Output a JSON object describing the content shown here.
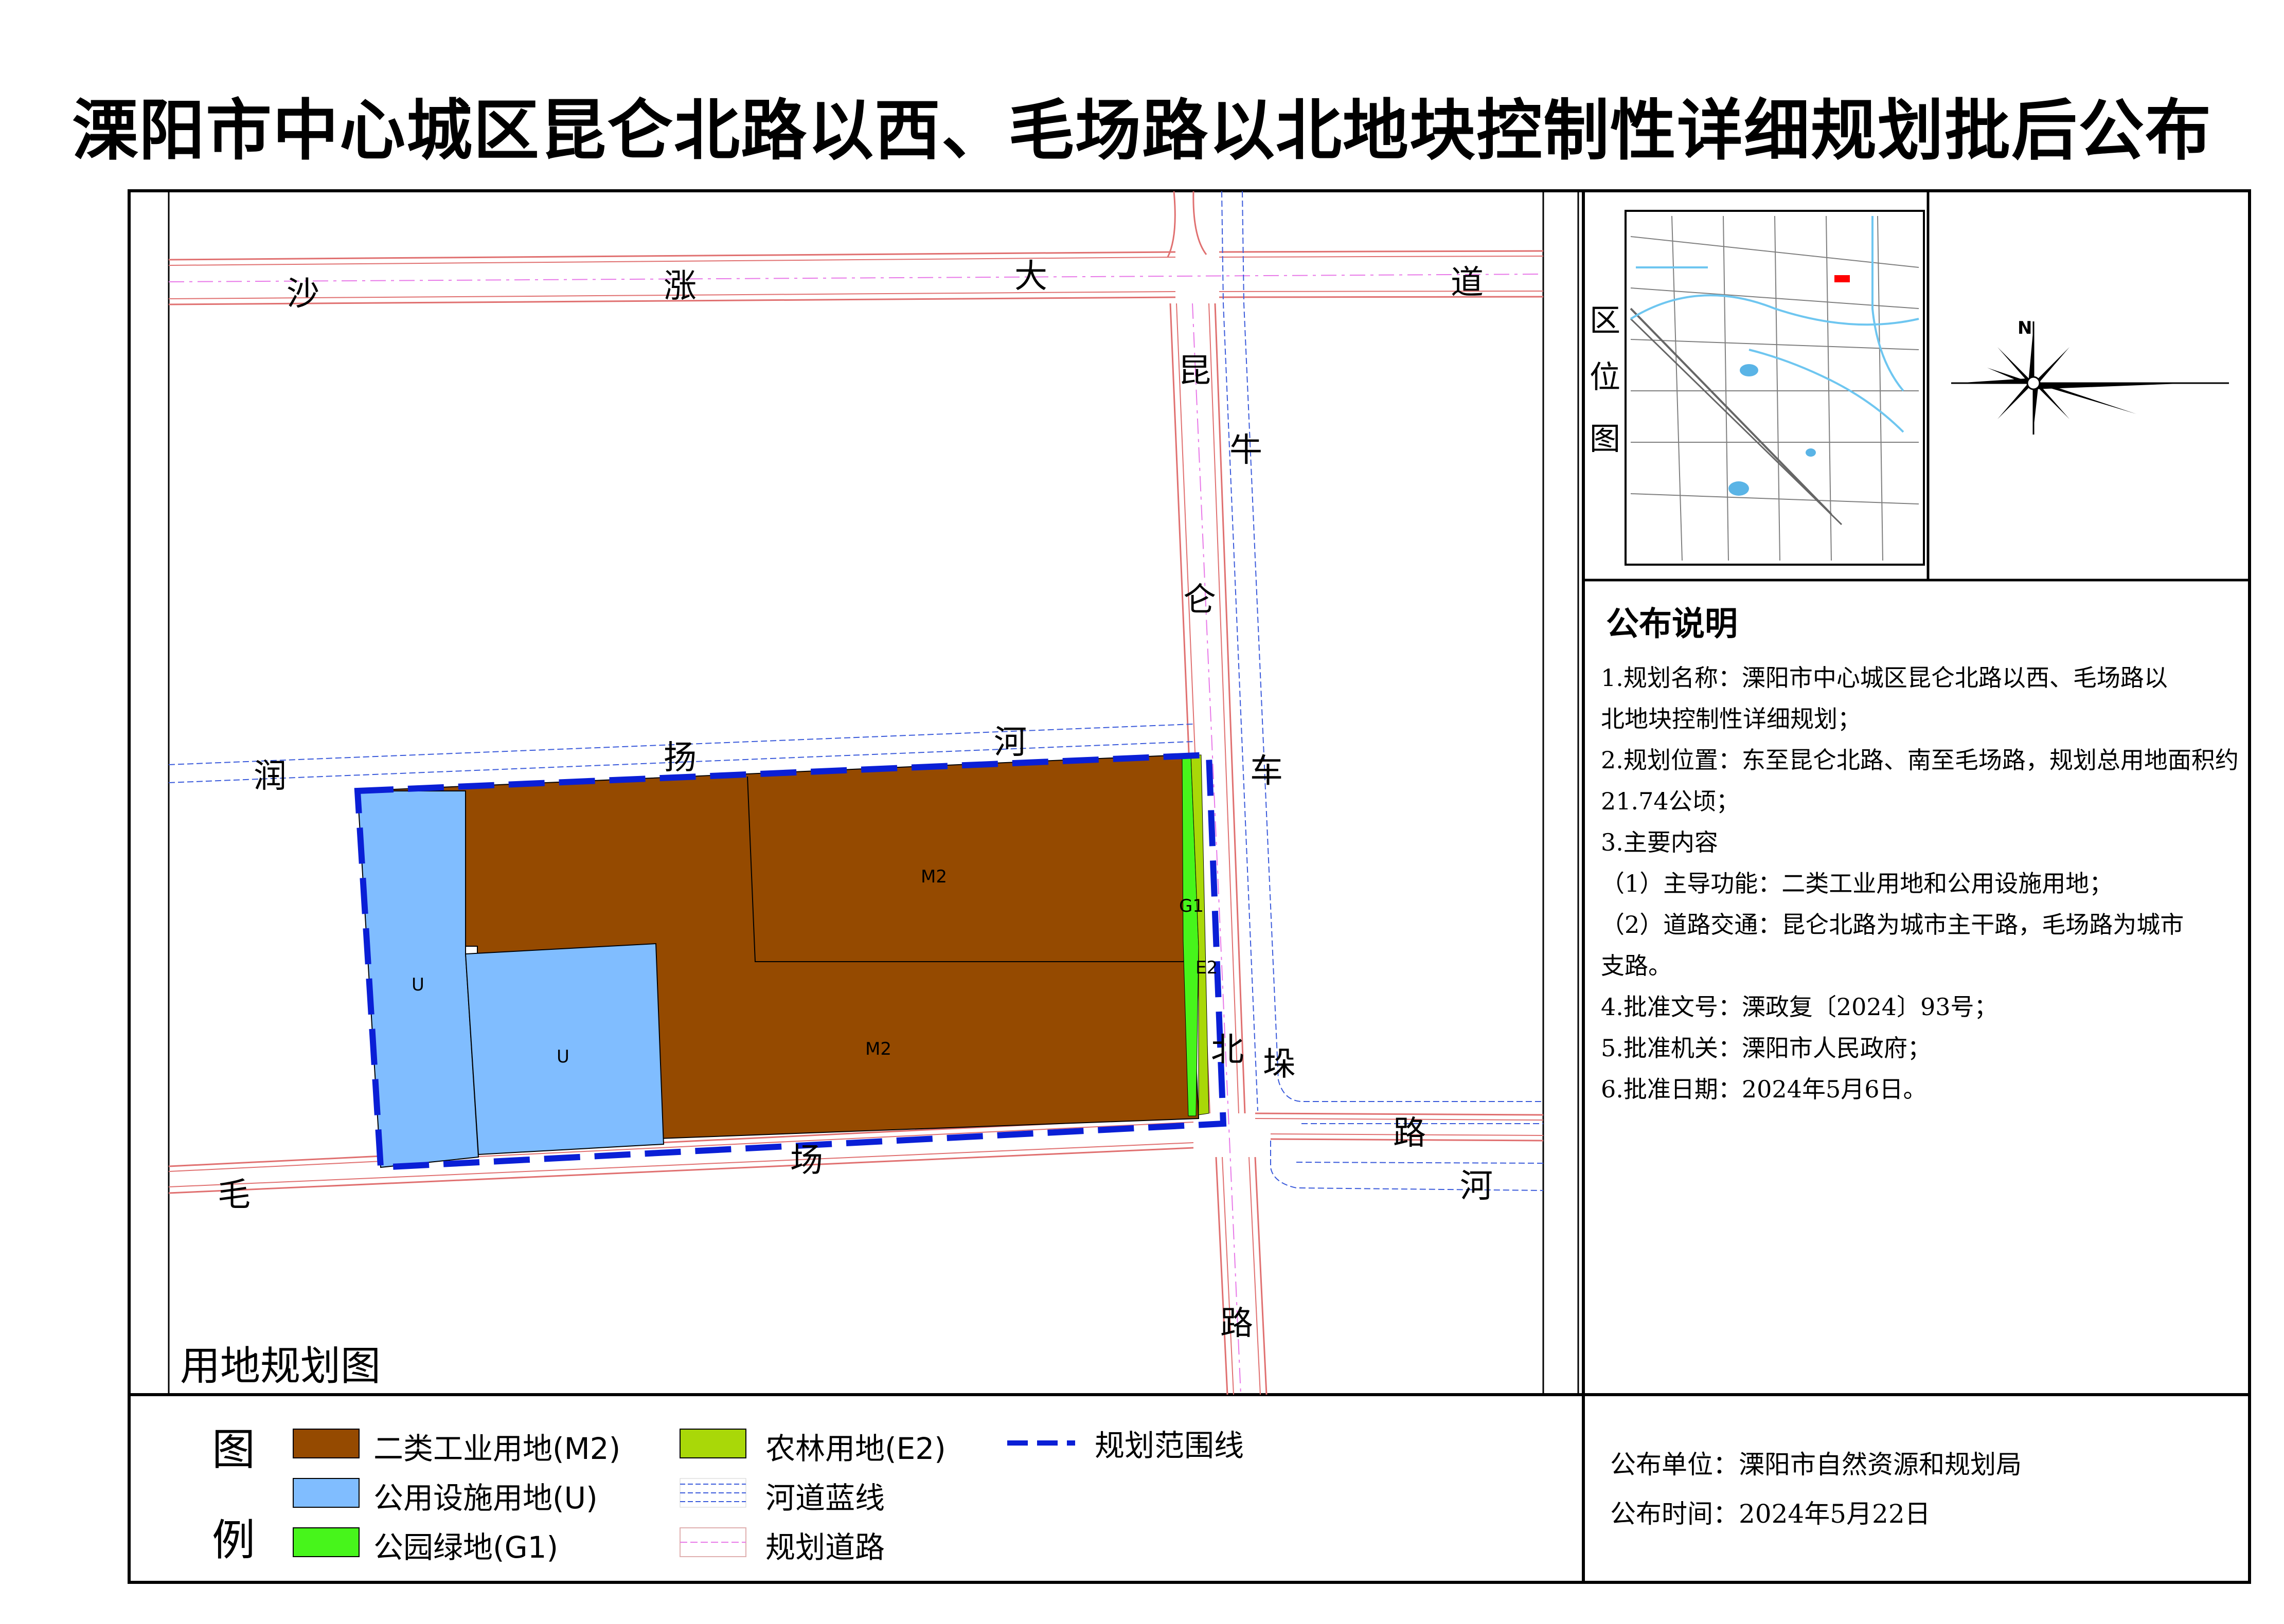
{
  "title": "溧阳市中心城区昆仑北路以西、毛场路以北地块控制性详细规划批后公布",
  "map": {
    "caption": "用地规划图",
    "roads": {
      "shazhang": [
        "沙",
        "涨",
        "大",
        "道"
      ],
      "kunlun": [
        "昆",
        "仑",
        "北",
        "路"
      ],
      "maochang": [
        "毛",
        "场",
        "路"
      ]
    },
    "rivers": {
      "runyang": [
        "润",
        "扬",
        "河"
      ],
      "niuchedu": [
        "牛",
        "车",
        "垛",
        "河"
      ]
    },
    "parcels": {
      "m2_north": "M2",
      "m2_south": "M2",
      "u_west": "U",
      "u_mid": "U",
      "g1": "G1",
      "e2": "E2"
    }
  },
  "inset": {
    "side_label": [
      "区",
      "位",
      "图"
    ],
    "north_label": "N"
  },
  "legend": {
    "heading": [
      "图",
      "例"
    ],
    "items": [
      {
        "label": "二类工业用地(M2)",
        "color": "#954a00"
      },
      {
        "label": "公用设施用地(U)",
        "color": "#80bdff"
      },
      {
        "label": "公园绿地(G1)",
        "color": "#47f51b"
      },
      {
        "label": "农林用地(E2)",
        "color": "#a9d808"
      },
      {
        "label": "河道蓝线",
        "color": "#3b5bdb"
      },
      {
        "label": "规划道路",
        "color": "#e07070"
      },
      {
        "label": "规划范围线",
        "color": "#0a1fd6"
      }
    ]
  },
  "notice": {
    "heading": "公布说明",
    "lines": [
      "1.规划名称：溧阳市中心城区昆仑北路以西、毛场路以",
      "北地块控制性详细规划；",
      "2.规划位置：东至昆仑北路、南至毛场路，规划总用地面积约",
      "21.74公顷；",
      "3.主要内容",
      "（1）主导功能：二类工业用地和公用设施用地；",
      "（2）道路交通：昆仑北路为城市主干路，毛场路为城市",
      "支路。",
      "4.批准文号：溧政复〔2024〕93号；",
      "5.批准机关：溧阳市人民政府；",
      "6.批准日期：2024年5月6日。"
    ]
  },
  "footer": {
    "publisher": "公布单位：溧阳市自然资源和规划局",
    "publish_time": "公布时间：2024年5月22日"
  }
}
